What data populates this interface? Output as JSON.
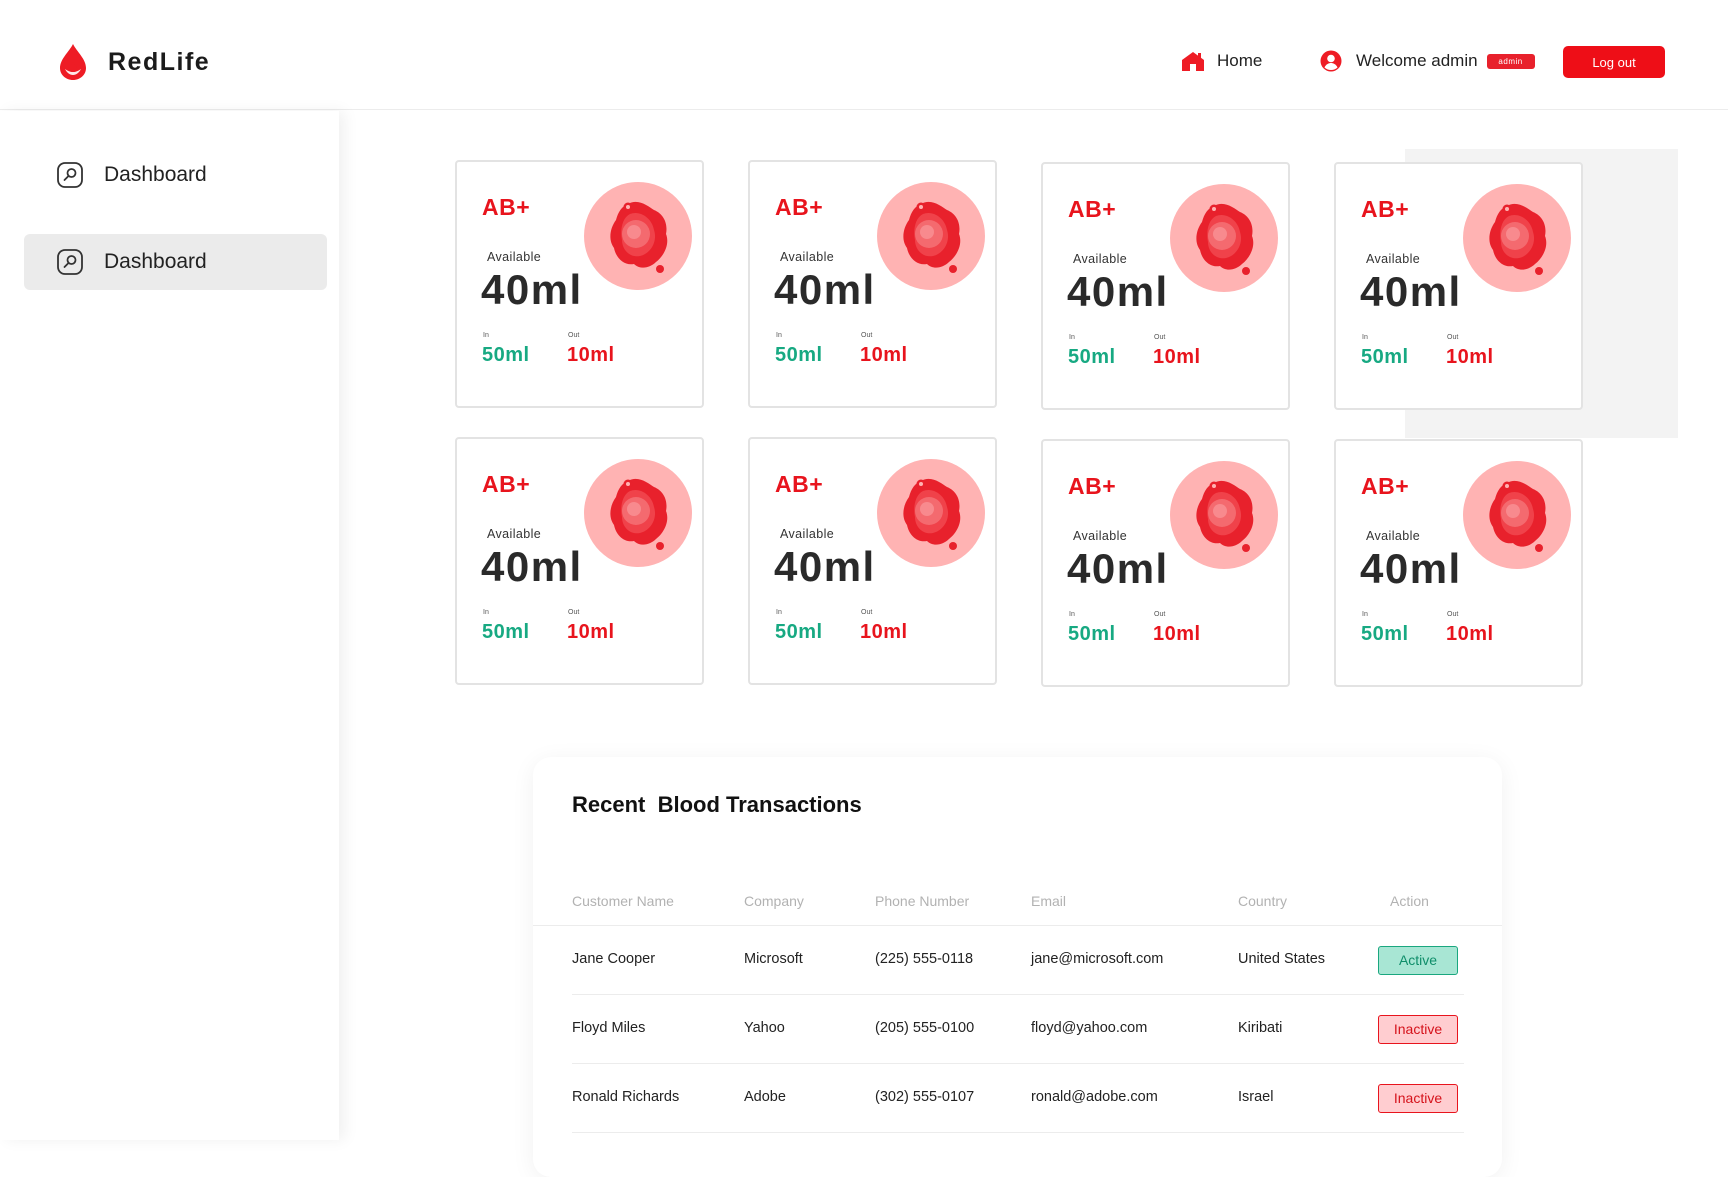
{
  "brand": {
    "name": "RedLife"
  },
  "nav": {
    "home_label": "Home",
    "welcome_label": "Welcome admin",
    "role_badge": "admin",
    "logout_label": "Log out"
  },
  "sidebar": {
    "items": [
      {
        "label": "Dashboard",
        "active": false
      },
      {
        "label": "Dashboard",
        "active": true
      }
    ]
  },
  "colors": {
    "accent": "#ee0e17",
    "green": "#17a982",
    "blood_light": "#ffb3b3"
  },
  "cards": [
    {
      "blood_type": "AB+",
      "available_label": "Available",
      "available": "40ml",
      "in_label": "In",
      "in": "50ml",
      "out_label": "Out",
      "out": "10ml"
    },
    {
      "blood_type": "AB+",
      "available_label": "Available",
      "available": "40ml",
      "in_label": "In",
      "in": "50ml",
      "out_label": "Out",
      "out": "10ml"
    },
    {
      "blood_type": "AB+",
      "available_label": "Available",
      "available": "40ml",
      "in_label": "In",
      "in": "50ml",
      "out_label": "Out",
      "out": "10ml"
    },
    {
      "blood_type": "AB+",
      "available_label": "Available",
      "available": "40ml",
      "in_label": "In",
      "in": "50ml",
      "out_label": "Out",
      "out": "10ml"
    },
    {
      "blood_type": "AB+",
      "available_label": "Available",
      "available": "40ml",
      "in_label": "In",
      "in": "50ml",
      "out_label": "Out",
      "out": "10ml"
    },
    {
      "blood_type": "AB+",
      "available_label": "Available",
      "available": "40ml",
      "in_label": "In",
      "in": "50ml",
      "out_label": "Out",
      "out": "10ml"
    },
    {
      "blood_type": "AB+",
      "available_label": "Available",
      "available": "40ml",
      "in_label": "In",
      "in": "50ml",
      "out_label": "Out",
      "out": "10ml"
    },
    {
      "blood_type": "AB+",
      "available_label": "Available",
      "available": "40ml",
      "in_label": "In",
      "in": "50ml",
      "out_label": "Out",
      "out": "10ml"
    }
  ],
  "transactions": {
    "title": "Recent  Blood Transactions",
    "columns": [
      "Customer Name",
      "Company",
      "Phone Number",
      "Email",
      "Country",
      "Action"
    ],
    "rows": [
      {
        "name": "Jane Cooper",
        "company": "Microsoft",
        "phone": "(225) 555-0118",
        "email": "jane@microsoft.com",
        "country": "United States",
        "status": "Active"
      },
      {
        "name": "Floyd Miles",
        "company": "Yahoo",
        "phone": "(205) 555-0100",
        "email": "floyd@yahoo.com",
        "country": "Kiribati",
        "status": "Inactive"
      },
      {
        "name": "Ronald Richards",
        "company": "Adobe",
        "phone": "(302) 555-0107",
        "email": "ronald@adobe.com",
        "country": "Israel",
        "status": "Inactive"
      }
    ]
  }
}
